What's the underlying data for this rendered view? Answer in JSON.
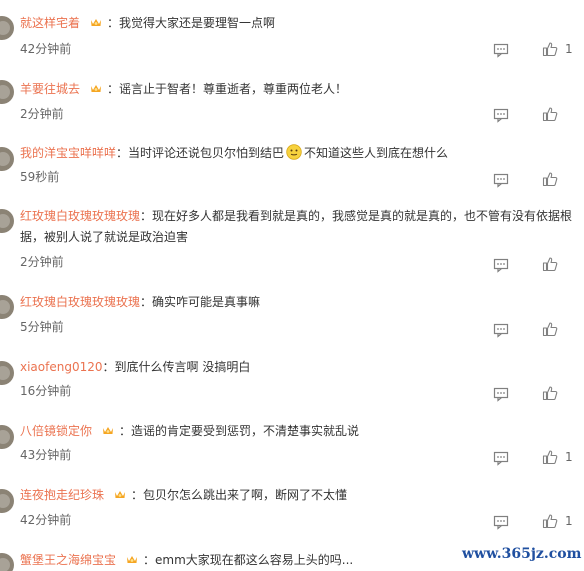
{
  "comments": [
    {
      "user": "就这样宅着",
      "verified": true,
      "text": "我觉得大家还是要理智一点啊",
      "time": "42分钟前",
      "likes": "1"
    },
    {
      "user": "羊要往城去",
      "verified": true,
      "text": "谣言止于智者！尊重逝者，尊重两位老人！",
      "time": "2分钟前",
      "likes": ""
    },
    {
      "user": "我的洋宝宝咩咩咩",
      "verified": false,
      "text_before_emoji": "当时评论还说包贝尔怕到结巴",
      "text_after_emoji": "不知道这些人到底在想什么",
      "time": "59秒前",
      "likes": ""
    },
    {
      "user": "红玫瑰白玫瑰玫瑰玫瑰",
      "verified": false,
      "text": "现在好多人都是我看到就是真的，我感觉是真的就是真的，也不管有没有依据根据，被别人说了就说是政治迫害",
      "time": "2分钟前",
      "likes": ""
    },
    {
      "user": "红玫瑰白玫瑰玫瑰玫瑰",
      "verified": false,
      "text": "确实咋可能是真事嘛",
      "time": "5分钟前",
      "likes": ""
    },
    {
      "user": "xiaofeng0120",
      "verified": false,
      "text": "到底什么传言啊 没搞明白",
      "time": "16分钟前",
      "likes": ""
    },
    {
      "user": "八倍镜锁定你",
      "verified": true,
      "text": "造谣的肯定要受到惩罚，不清楚事实就乱说",
      "time": "43分钟前",
      "likes": "1"
    },
    {
      "user": "连夜抱走纪珍珠",
      "verified": true,
      "text": "包贝尔怎么跳出来了啊，断网了不太懂",
      "time": "42分钟前",
      "likes": "1"
    },
    {
      "user": "蟹堡王之海绵宝宝",
      "verified": true,
      "text": "emm大家现在都这么容易上头的吗...",
      "time": "",
      "likes": ""
    }
  ],
  "watermark": "www.365jz.com",
  "colors": {
    "username": "#eb7350",
    "text": "#333333",
    "time": "#666666",
    "icon": "#808080",
    "badge": "#f5a623"
  }
}
